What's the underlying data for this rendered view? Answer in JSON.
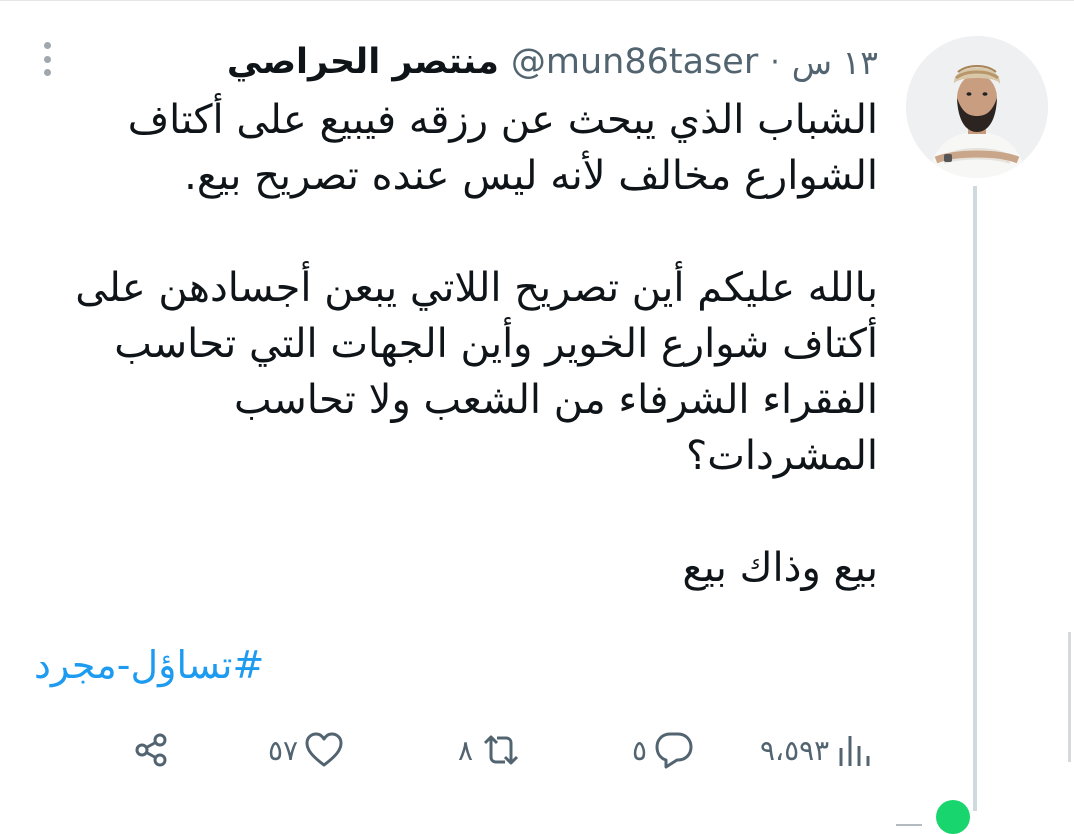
{
  "tweet": {
    "display_name": "منتصر الحراصي",
    "handle": "@mun86taser",
    "separator": "·",
    "time": "١٣ س",
    "body": {
      "line1": "الشباب الذي يبحث عن رزقه فيبيع على أكتاف",
      "line2": "الشوارع مخالف لأنه ليس عنده تصريح بيع.",
      "line3": "بالله عليكم أين تصريح اللاتي يبعن أجسادهن على",
      "line4": "أكتاف شوارع الخوير وأين الجهات التي تحاسب",
      "line5": "الفقراء الشرفاء من الشعب ولا تحاسب المشردات؟",
      "line6": "بيع وذاك بيع"
    },
    "hashtag": "#تساؤل-مجرد"
  },
  "actions": {
    "replies": "٥",
    "retweets": "٨",
    "likes": "٥٧",
    "views": "٩،٥٩٣"
  },
  "icons": {
    "more": "more-vertical-icon",
    "share": "share-icon",
    "like": "heart-icon",
    "retweet": "retweet-icon",
    "reply": "reply-icon",
    "views": "views-icon"
  },
  "colors": {
    "accent": "#1d9bf0",
    "text": "#0f1419",
    "muted": "#536471",
    "online": "#19d56d"
  }
}
